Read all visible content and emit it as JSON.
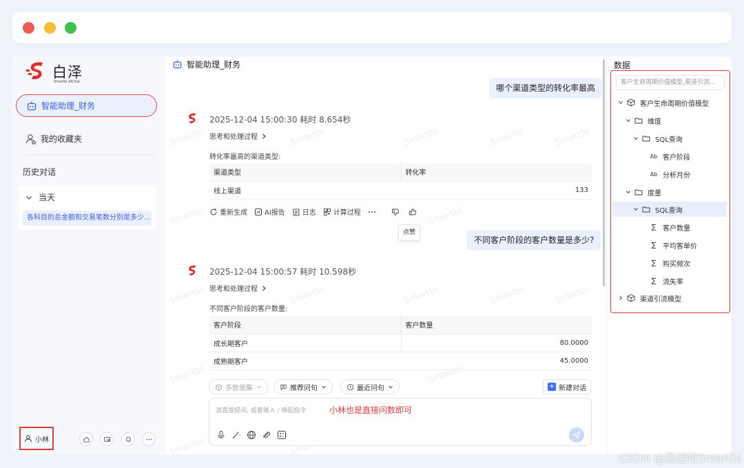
{
  "window": {
    "title": "智能助理_财务"
  },
  "sidebar": {
    "brand_name": "白泽",
    "brand_sub": "Smartbi AIChat",
    "active_item": "智能助理_财务",
    "favorites": "我的收藏夹",
    "history_label": "历史对话",
    "today_label": "当天",
    "today_items": [
      "各科目的总金额和交易笔数分别是多少..."
    ],
    "user_name": "小林"
  },
  "chat": {
    "title": "智能助理_财务",
    "q1": "哪个渠道类型的转化率最高",
    "a1": {
      "timestamp": "2025-12-04 15:00:30 耗时 8.654秒",
      "thinking": "思考和处理过程",
      "caption": "转化率最高的渠道类型:",
      "columns": [
        "渠道类型",
        "转化率"
      ],
      "rows": [
        [
          "线上渠道",
          "133"
        ]
      ]
    },
    "actions": [
      "重新生成",
      "AI报告",
      "日志",
      "计算过程"
    ],
    "tooltip": "点赞",
    "q2": "不同客户阶段的客户数量是多少?",
    "a2": {
      "timestamp": "2025-12-04 15:00:57 耗时 10.598秒",
      "thinking": "思考和处理过程",
      "caption": "不同客户阶段的客户数量:",
      "columns": [
        "客户阶段",
        "客户数量"
      ],
      "rows": [
        [
          "成长期客户",
          "80.0000"
        ],
        [
          "成熟期客户",
          "45.0000"
        ]
      ]
    },
    "watermark": "Smartbi"
  },
  "composer": {
    "dataset": "多数据集",
    "recommend": "推荐问句",
    "recent": "最近问句",
    "new_conversation": "新建对话",
    "placeholder": "请直接提问, 或者输入 / 唤起指令",
    "annotation": "小林也是直接问数即可"
  },
  "data_panel": {
    "title": "数据",
    "search_placeholder": "客户生命周期价值模型,渠道引流...",
    "tree": [
      {
        "label": "客户生命周期价值模型",
        "icon": "cube-icon"
      },
      {
        "label": "维度",
        "icon": "folder-icon"
      },
      {
        "label": "SQL查询",
        "icon": "folder-icon"
      },
      {
        "label": "客户阶段",
        "icon": "text-field-icon"
      },
      {
        "label": "分析月份",
        "icon": "text-field-icon"
      },
      {
        "label": "度量",
        "icon": "folder-icon"
      },
      {
        "label": "SQL查询",
        "icon": "folder-icon"
      },
      {
        "label": "客户数量",
        "icon": "sum-icon"
      },
      {
        "label": "平均客单价",
        "icon": "sum-icon"
      },
      {
        "label": "购买频次",
        "icon": "sum-icon"
      },
      {
        "label": "流失率",
        "icon": "sum-icon"
      },
      {
        "label": "渠道引流模型",
        "icon": "cube-icon"
      }
    ],
    "text_field_glyph": "Ab",
    "sum_glyph": "∑"
  },
  "footer": {
    "watermark": "CSDN @思迈特Smartbi"
  },
  "colors": {
    "accent": "#3c5fe8",
    "highlight_border": "#e23b3b",
    "active_bg": "#eaf0fe"
  }
}
